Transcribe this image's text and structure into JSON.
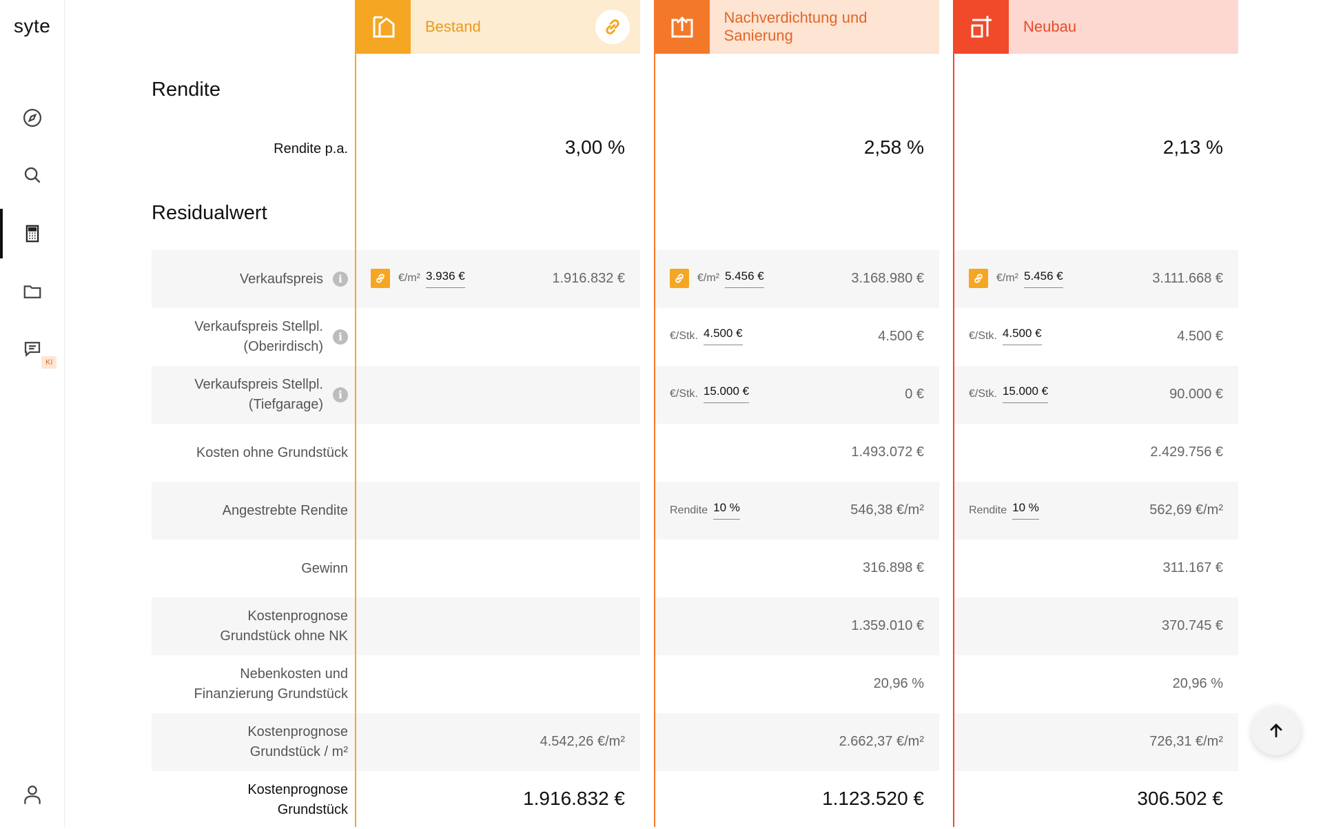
{
  "app": {
    "logo": "syte"
  },
  "sidebar": {
    "items": [
      {
        "name": "explore",
        "icon": "compass-icon"
      },
      {
        "name": "search",
        "icon": "search-icon"
      },
      {
        "name": "calculator",
        "icon": "calculator-icon",
        "active": true
      },
      {
        "name": "projects",
        "icon": "folder-icon"
      },
      {
        "name": "chat",
        "icon": "chat-icon",
        "badge": "KI"
      }
    ],
    "user_icon": "user-icon"
  },
  "columns": [
    {
      "title": "Bestand",
      "icon": "house-icon",
      "accent": "#f5a623",
      "head_bg": "#fdecd0",
      "title_color": "#e89a1a"
    },
    {
      "title": "Nachverdichtung und Sanierung",
      "icon": "house-upload-icon",
      "accent": "#f4782a",
      "head_bg": "#fde4d3",
      "title_color": "#e0672a"
    },
    {
      "title": "Neubau",
      "icon": "crane-icon",
      "accent": "#f04a2a",
      "head_bg": "#fdd8d1",
      "title_color": "#e8492a"
    }
  ],
  "sections": {
    "rendite": "Rendite",
    "residualwert": "Residualwert"
  },
  "rendite": {
    "label": "Rendite p.a.",
    "values": [
      "3,00 %",
      "2,58 %",
      "2,13 %"
    ]
  },
  "rows": {
    "verkaufspreis": {
      "label": "Verkaufspreis",
      "cells": [
        {
          "unit": "€/m²",
          "input": "3.936 €",
          "value": "1.916.832 €"
        },
        {
          "unit": "€/m²",
          "input": "5.456 €",
          "value": "3.168.980 €"
        },
        {
          "unit": "€/m²",
          "input": "5.456 €",
          "value": "3.111.668 €"
        }
      ]
    },
    "stellpl_ober": {
      "label": "Verkaufspreis Stellpl. (Oberirdisch)",
      "cells": [
        {
          "unit": "",
          "input": "",
          "value": ""
        },
        {
          "unit": "€/Stk.",
          "input": "4.500 €",
          "value": "4.500 €"
        },
        {
          "unit": "€/Stk.",
          "input": "4.500 €",
          "value": "4.500 €"
        }
      ]
    },
    "stellpl_tief": {
      "label": "Verkaufspreis Stellpl. (Tiefgarage)",
      "cells": [
        {
          "unit": "",
          "input": "",
          "value": ""
        },
        {
          "unit": "€/Stk.",
          "input": "15.000 €",
          "value": "0 €"
        },
        {
          "unit": "€/Stk.",
          "input": "15.000 €",
          "value": "90.000 €"
        }
      ]
    },
    "kosten_ohne": {
      "label": "Kosten ohne Grundstück",
      "values": [
        "",
        "1.493.072 €",
        "2.429.756 €"
      ]
    },
    "angestrebt": {
      "label": "Angestrebte Rendite",
      "cells": [
        {
          "unit": "",
          "input": "",
          "value": ""
        },
        {
          "unit": "Rendite",
          "input": "10 %",
          "value": "546,38 €/m²"
        },
        {
          "unit": "Rendite",
          "input": "10 %",
          "value": "562,69 €/m²"
        }
      ]
    },
    "gewinn": {
      "label": "Gewinn",
      "values": [
        "",
        "316.898 €",
        "311.167 €"
      ]
    },
    "kostenprognose_ohne_nk": {
      "label": "Kostenprognose Grundstück ohne NK",
      "values": [
        "",
        "1.359.010 €",
        "370.745 €"
      ]
    },
    "nebenkosten": {
      "label": "Nebenkosten und Finanzierung Grundstück",
      "values": [
        "",
        "20,96 %",
        "20,96 %"
      ]
    },
    "kostenprognose_m2": {
      "label": "Kostenprognose Grundstück / m²",
      "values": [
        "4.542,26 €/m²",
        "2.662,37 €/m²",
        "726,31 €/m²"
      ]
    },
    "kostenprognose": {
      "label": "Kostenprognose Grundstück",
      "values": [
        "1.916.832 €",
        "1.123.520 €",
        "306.502 €"
      ]
    }
  }
}
